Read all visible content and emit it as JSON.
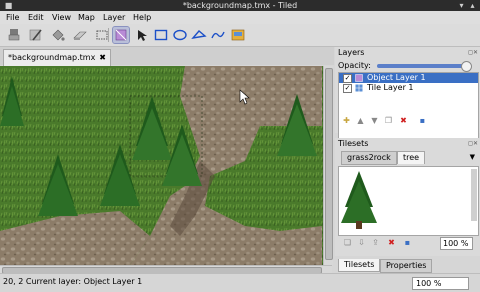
{
  "window": {
    "title": "*backgroundmap.tmx - Tiled"
  },
  "menu": [
    "File",
    "Edit",
    "View",
    "Map",
    "Layer",
    "Help"
  ],
  "toolbar": {
    "icons": [
      "stamp-brush",
      "terrain-brush",
      "bucket-fill",
      "eraser",
      "rectangle-select",
      "tile-select",
      "object-select",
      "edit-polygons",
      "insert-rectangle",
      "insert-ellipse",
      "insert-polygon",
      "insert-polyline",
      "insert-tile"
    ],
    "active": "tile-select"
  },
  "document_tab": {
    "label": "*backgroundmap.tmx",
    "close": "✖"
  },
  "layers_panel": {
    "title": "Layers",
    "opacity_label": "Opacity:",
    "opacity": 1.0,
    "layers": [
      {
        "name": "Object Layer 1",
        "visible": true,
        "type": "object",
        "selected": true
      },
      {
        "name": "Tile Layer 1",
        "visible": true,
        "type": "tile",
        "selected": false
      }
    ]
  },
  "tilesets_panel": {
    "title": "Tilesets",
    "tabs": [
      "grass2rock",
      "tree"
    ],
    "active_tab": "tree",
    "zoom": "100 %"
  },
  "bottom_tabs": [
    "Tilesets",
    "Properties"
  ],
  "status": {
    "text": "20, 2  Current layer: Object Layer 1",
    "zoom": "100 %"
  },
  "colors": {
    "selection": "#3a6fc4",
    "grass": "#4c7a2c",
    "path": "#8a7a66"
  }
}
